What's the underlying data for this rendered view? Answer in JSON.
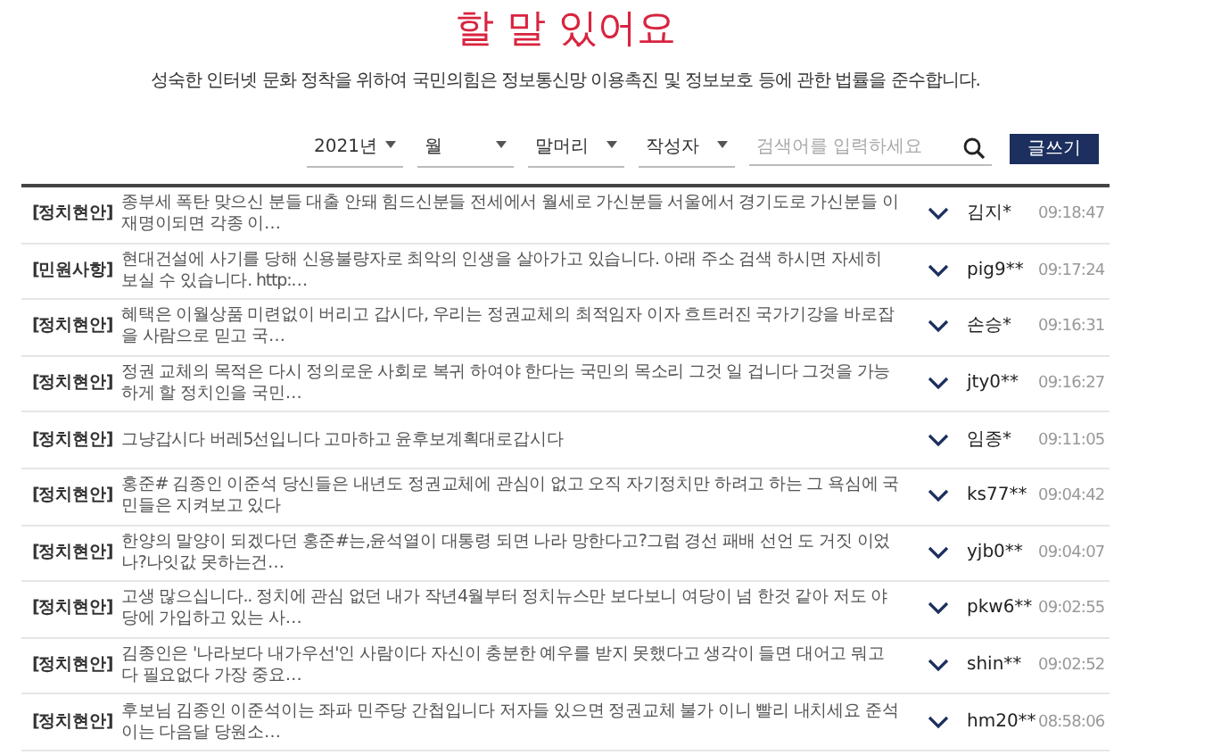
{
  "title": "할 말 있어요",
  "notice": "성숙한 인터넷 문화 정착을 위하여 국민의힘은 정보통신망 이용촉진 및 정보보호 등에 관한 법률을 준수합니다.",
  "filters": [
    {
      "label": "2021년"
    },
    {
      "label": "월"
    },
    {
      "label": "말머리"
    },
    {
      "label": "작성자"
    }
  ],
  "search": {
    "placeholder": "검색어를 입력하세요"
  },
  "write_button": "글쓰기",
  "posts": [
    {
      "category": "[정치현안]",
      "text": "종부세 폭탄 맞으신 분들 대출 안돼 힘드신분들 전세에서 월세로 가신분들 서울에서 경기도로 가신분들 이재명이되면 각종 이…",
      "author": "김지*",
      "time": "09:18:47"
    },
    {
      "category": "[민원사항]",
      "text": "현대건설에 사기를 당해 신용불량자로 최악의 인생을 살아가고 있습니다. 아래 주소 검색 하시면 자세히 보실 수 있습니다. http:…",
      "author": "pig9**",
      "time": "09:17:24"
    },
    {
      "category": "[정치현안]",
      "text": "혜택은 이월상품 미련없이 버리고 갑시다, 우리는 정권교체의 최적임자 이자 흐트러진 국가기강을 바로잡을 사람으로 믿고 국…",
      "author": "손승*",
      "time": "09:16:31"
    },
    {
      "category": "[정치현안]",
      "text": "정권 교체의 목적은 다시 정의로운 사회로 복귀 하여야 한다는 국민의 목소리 그것 일 겁니다 그것을 가능 하게 할 정치인을 국민…",
      "author": "jty0**",
      "time": "09:16:27"
    },
    {
      "category": "[정치현안]",
      "text": "그냥갑시다 버레5선입니다 고마하고 윤후보계획대로갑시다",
      "author": "임종*",
      "time": "09:11:05"
    },
    {
      "category": "[정치현안]",
      "text": "홍준#  김종인 이준석 당신들은 내년도 정권교체에 관심이 없고 오직 자기정치만 하려고 하는 그 욕심에 국민들은 지켜보고 있다",
      "author": "ks77**",
      "time": "09:04:42"
    },
    {
      "category": "[정치현안]",
      "text": "한양의 말양이 되겠다던 홍준#는,윤석열이 대통령 되면 나라 망한다고?그럼 경선 패배 선언 도 거짓 이었나?나잇값 못하는건…",
      "author": "yjb0**",
      "time": "09:04:07"
    },
    {
      "category": "[정치현안]",
      "text": "고생 많으십니다.. 정치에 관심 없던 내가 작년4월부터 정치뉴스만 보다보니 여당이 넘 한것 같아 저도 야당에 가입하고 있는 사…",
      "author": "pkw6**",
      "time": "09:02:55"
    },
    {
      "category": "[정치현안]",
      "text": "김종인은 '나라보다 내가우선'인 사람이다 자신이 충분한 예우를 받지 못했다고 생각이 들면 대어고 뭐고 다 필요없다 가장 중요…",
      "author": "shin**",
      "time": "09:02:52"
    },
    {
      "category": "[정치현안]",
      "text": "후보님 김종인 이준석이는 좌파 민주당 간첩입니다 저자들 있으면 정권교체 불가 이니 빨리 내치세요 준석이는 다음달 당원소…",
      "author": "hm20**",
      "time": "08:58:06"
    }
  ]
}
